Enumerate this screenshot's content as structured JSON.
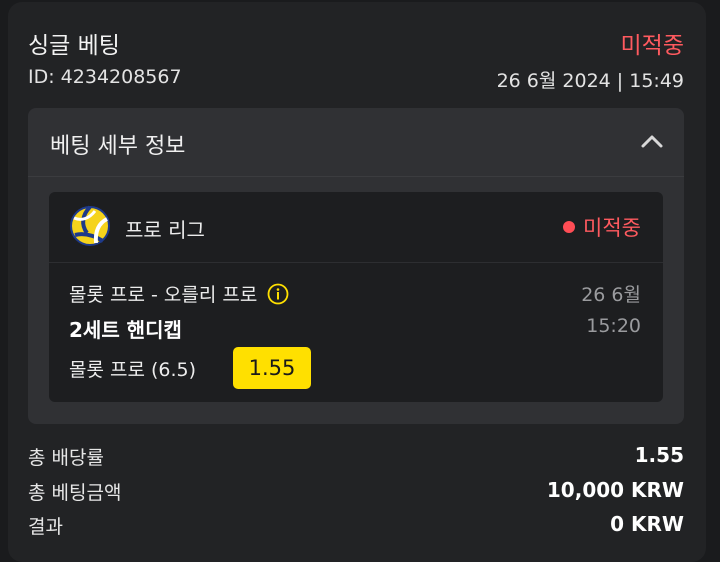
{
  "bet": {
    "type_title": "싱글 베팅",
    "status": "미적중",
    "id_text": "ID: 4234208567",
    "datetime": "26 6월 2024 | 15:49"
  },
  "details": {
    "title": "베팅 세부 정보",
    "collapse_icon": "chevron-up-icon",
    "event": {
      "sport_icon": "volleyball-icon",
      "league": "프로 리그",
      "status": "미적중",
      "match": "몰롯 프로 - 오를리 프로",
      "date": "26 6월",
      "market": "2세트 핸디캡",
      "time": "15:20",
      "selection": "몰롯 프로 (6.5)",
      "odds": "1.55"
    }
  },
  "summary": {
    "total_odds_label": "총 배당률",
    "total_odds_value": "1.55",
    "stake_label": "총 베팅금액",
    "stake_value": "10,000 KRW",
    "result_label": "결과",
    "result_value": "0 KRW"
  },
  "colors": {
    "lost": "#ff5a5f",
    "odds_highlight": "#ffe000",
    "card_bg": "#222325",
    "panel_bg": "#303134",
    "event_bg": "#1d1e20"
  }
}
